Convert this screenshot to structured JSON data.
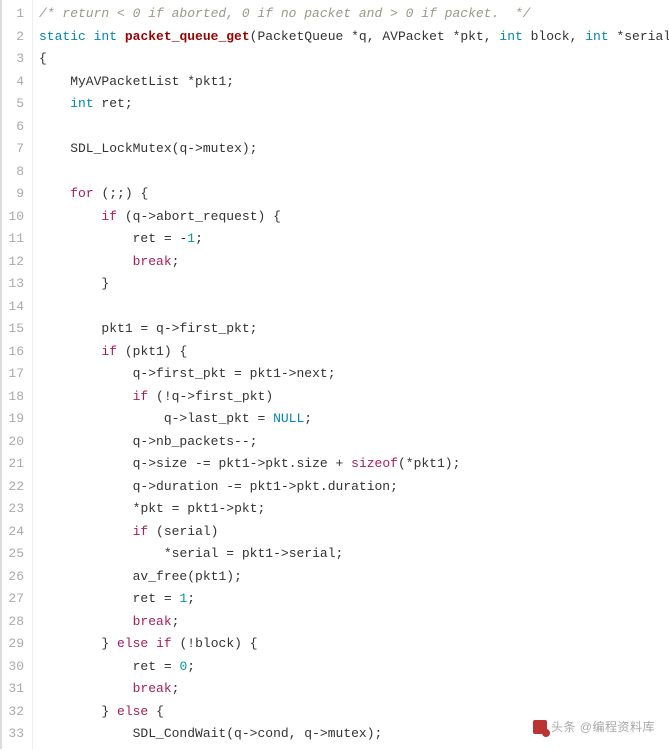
{
  "watermark": "头条 @编程资料库",
  "lines": [
    {
      "n": 1,
      "tokens": [
        [
          "c",
          "/* return < 0 if aborted, 0 if no packet and > 0 if packet.  */"
        ]
      ]
    },
    {
      "n": 2,
      "tokens": [
        [
          "kb",
          "static"
        ],
        [
          "n",
          " "
        ],
        [
          "kb",
          "int"
        ],
        [
          "n",
          " "
        ],
        [
          "nf",
          "packet_queue_get"
        ],
        [
          "p",
          "("
        ],
        [
          "n",
          "PacketQueue "
        ],
        [
          "o",
          "*"
        ],
        [
          "n",
          "q"
        ],
        [
          "p",
          ", "
        ],
        [
          "n",
          "AVPacket "
        ],
        [
          "o",
          "*"
        ],
        [
          "n",
          "pkt"
        ],
        [
          "p",
          ", "
        ],
        [
          "kb",
          "int"
        ],
        [
          "n",
          " block"
        ],
        [
          "p",
          ", "
        ],
        [
          "kb",
          "int"
        ],
        [
          "n",
          " "
        ],
        [
          "o",
          "*"
        ],
        [
          "n",
          "serial"
        ],
        [
          "p",
          ")"
        ]
      ]
    },
    {
      "n": 3,
      "tokens": [
        [
          "p",
          "{"
        ]
      ]
    },
    {
      "n": 4,
      "tokens": [
        [
          "n",
          "    MyAVPacketList "
        ],
        [
          "o",
          "*"
        ],
        [
          "n",
          "pkt1"
        ],
        [
          "p",
          ";"
        ]
      ]
    },
    {
      "n": 5,
      "tokens": [
        [
          "n",
          "    "
        ],
        [
          "kb",
          "int"
        ],
        [
          "n",
          " ret"
        ],
        [
          "p",
          ";"
        ]
      ]
    },
    {
      "n": 6,
      "tokens": []
    },
    {
      "n": 7,
      "tokens": [
        [
          "n",
          "    SDL_LockMutex"
        ],
        [
          "p",
          "("
        ],
        [
          "n",
          "q"
        ],
        [
          "o",
          "->"
        ],
        [
          "n",
          "mutex"
        ],
        [
          "p",
          ");"
        ]
      ]
    },
    {
      "n": 8,
      "tokens": []
    },
    {
      "n": 9,
      "tokens": [
        [
          "n",
          "    "
        ],
        [
          "k",
          "for"
        ],
        [
          "n",
          " "
        ],
        [
          "p",
          "(;;) {"
        ]
      ]
    },
    {
      "n": 10,
      "tokens": [
        [
          "n",
          "        "
        ],
        [
          "k",
          "if"
        ],
        [
          "n",
          " "
        ],
        [
          "p",
          "("
        ],
        [
          "n",
          "q"
        ],
        [
          "o",
          "->"
        ],
        [
          "n",
          "abort_request"
        ],
        [
          "p",
          ") {"
        ]
      ]
    },
    {
      "n": 11,
      "tokens": [
        [
          "n",
          "            ret "
        ],
        [
          "o",
          "="
        ],
        [
          "n",
          " "
        ],
        [
          "o",
          "-"
        ],
        [
          "mi",
          "1"
        ],
        [
          "p",
          ";"
        ]
      ]
    },
    {
      "n": 12,
      "tokens": [
        [
          "n",
          "            "
        ],
        [
          "k",
          "break"
        ],
        [
          "p",
          ";"
        ]
      ]
    },
    {
      "n": 13,
      "tokens": [
        [
          "n",
          "        "
        ],
        [
          "p",
          "}"
        ]
      ]
    },
    {
      "n": 14,
      "tokens": []
    },
    {
      "n": 15,
      "tokens": [
        [
          "n",
          "        pkt1 "
        ],
        [
          "o",
          "="
        ],
        [
          "n",
          " q"
        ],
        [
          "o",
          "->"
        ],
        [
          "n",
          "first_pkt"
        ],
        [
          "p",
          ";"
        ]
      ]
    },
    {
      "n": 16,
      "tokens": [
        [
          "n",
          "        "
        ],
        [
          "k",
          "if"
        ],
        [
          "n",
          " "
        ],
        [
          "p",
          "("
        ],
        [
          "n",
          "pkt1"
        ],
        [
          "p",
          ") {"
        ]
      ]
    },
    {
      "n": 17,
      "tokens": [
        [
          "n",
          "            q"
        ],
        [
          "o",
          "->"
        ],
        [
          "n",
          "first_pkt "
        ],
        [
          "o",
          "="
        ],
        [
          "n",
          " pkt1"
        ],
        [
          "o",
          "->"
        ],
        [
          "n",
          "next"
        ],
        [
          "p",
          ";"
        ]
      ]
    },
    {
      "n": 18,
      "tokens": [
        [
          "n",
          "            "
        ],
        [
          "k",
          "if"
        ],
        [
          "n",
          " "
        ],
        [
          "p",
          "("
        ],
        [
          "o",
          "!"
        ],
        [
          "n",
          "q"
        ],
        [
          "o",
          "->"
        ],
        [
          "n",
          "first_pkt"
        ],
        [
          "p",
          ")"
        ]
      ]
    },
    {
      "n": 19,
      "tokens": [
        [
          "n",
          "                q"
        ],
        [
          "o",
          "->"
        ],
        [
          "n",
          "last_pkt "
        ],
        [
          "o",
          "="
        ],
        [
          "n",
          " "
        ],
        [
          "kb",
          "NULL"
        ],
        [
          "p",
          ";"
        ]
      ]
    },
    {
      "n": 20,
      "tokens": [
        [
          "n",
          "            q"
        ],
        [
          "o",
          "->"
        ],
        [
          "n",
          "nb_packets"
        ],
        [
          "o",
          "--"
        ],
        [
          "p",
          ";"
        ]
      ]
    },
    {
      "n": 21,
      "tokens": [
        [
          "n",
          "            q"
        ],
        [
          "o",
          "->"
        ],
        [
          "n",
          "size "
        ],
        [
          "o",
          "-="
        ],
        [
          "n",
          " pkt1"
        ],
        [
          "o",
          "->"
        ],
        [
          "n",
          "pkt"
        ],
        [
          "p",
          "."
        ],
        [
          "n",
          "size "
        ],
        [
          "o",
          "+"
        ],
        [
          "n",
          " "
        ],
        [
          "k",
          "sizeof"
        ],
        [
          "p",
          "("
        ],
        [
          "o",
          "*"
        ],
        [
          "n",
          "pkt1"
        ],
        [
          "p",
          ");"
        ]
      ]
    },
    {
      "n": 22,
      "tokens": [
        [
          "n",
          "            q"
        ],
        [
          "o",
          "->"
        ],
        [
          "n",
          "duration "
        ],
        [
          "o",
          "-="
        ],
        [
          "n",
          " pkt1"
        ],
        [
          "o",
          "->"
        ],
        [
          "n",
          "pkt"
        ],
        [
          "p",
          "."
        ],
        [
          "n",
          "duration"
        ],
        [
          "p",
          ";"
        ]
      ]
    },
    {
      "n": 23,
      "tokens": [
        [
          "n",
          "            "
        ],
        [
          "o",
          "*"
        ],
        [
          "n",
          "pkt "
        ],
        [
          "o",
          "="
        ],
        [
          "n",
          " pkt1"
        ],
        [
          "o",
          "->"
        ],
        [
          "n",
          "pkt"
        ],
        [
          "p",
          ";"
        ]
      ]
    },
    {
      "n": 24,
      "tokens": [
        [
          "n",
          "            "
        ],
        [
          "k",
          "if"
        ],
        [
          "n",
          " "
        ],
        [
          "p",
          "("
        ],
        [
          "n",
          "serial"
        ],
        [
          "p",
          ")"
        ]
      ]
    },
    {
      "n": 25,
      "tokens": [
        [
          "n",
          "                "
        ],
        [
          "o",
          "*"
        ],
        [
          "n",
          "serial "
        ],
        [
          "o",
          "="
        ],
        [
          "n",
          " pkt1"
        ],
        [
          "o",
          "->"
        ],
        [
          "n",
          "serial"
        ],
        [
          "p",
          ";"
        ]
      ]
    },
    {
      "n": 26,
      "tokens": [
        [
          "n",
          "            av_free"
        ],
        [
          "p",
          "("
        ],
        [
          "n",
          "pkt1"
        ],
        [
          "p",
          ");"
        ]
      ]
    },
    {
      "n": 27,
      "tokens": [
        [
          "n",
          "            ret "
        ],
        [
          "o",
          "="
        ],
        [
          "n",
          " "
        ],
        [
          "mi",
          "1"
        ],
        [
          "p",
          ";"
        ]
      ]
    },
    {
      "n": 28,
      "tokens": [
        [
          "n",
          "            "
        ],
        [
          "k",
          "break"
        ],
        [
          "p",
          ";"
        ]
      ]
    },
    {
      "n": 29,
      "tokens": [
        [
          "n",
          "        "
        ],
        [
          "p",
          "} "
        ],
        [
          "k",
          "else"
        ],
        [
          "n",
          " "
        ],
        [
          "k",
          "if"
        ],
        [
          "n",
          " "
        ],
        [
          "p",
          "("
        ],
        [
          "o",
          "!"
        ],
        [
          "n",
          "block"
        ],
        [
          "p",
          ") {"
        ]
      ]
    },
    {
      "n": 30,
      "tokens": [
        [
          "n",
          "            ret "
        ],
        [
          "o",
          "="
        ],
        [
          "n",
          " "
        ],
        [
          "mi",
          "0"
        ],
        [
          "p",
          ";"
        ]
      ]
    },
    {
      "n": 31,
      "tokens": [
        [
          "n",
          "            "
        ],
        [
          "k",
          "break"
        ],
        [
          "p",
          ";"
        ]
      ]
    },
    {
      "n": 32,
      "tokens": [
        [
          "n",
          "        "
        ],
        [
          "p",
          "} "
        ],
        [
          "k",
          "else"
        ],
        [
          "n",
          " "
        ],
        [
          "p",
          "{"
        ]
      ]
    },
    {
      "n": 33,
      "tokens": [
        [
          "n",
          "            SDL_CondWait"
        ],
        [
          "p",
          "("
        ],
        [
          "n",
          "q"
        ],
        [
          "o",
          "->"
        ],
        [
          "n",
          "cond"
        ],
        [
          "p",
          ", "
        ],
        [
          "n",
          "q"
        ],
        [
          "o",
          "->"
        ],
        [
          "n",
          "mutex"
        ],
        [
          "p",
          ");"
        ]
      ]
    }
  ]
}
